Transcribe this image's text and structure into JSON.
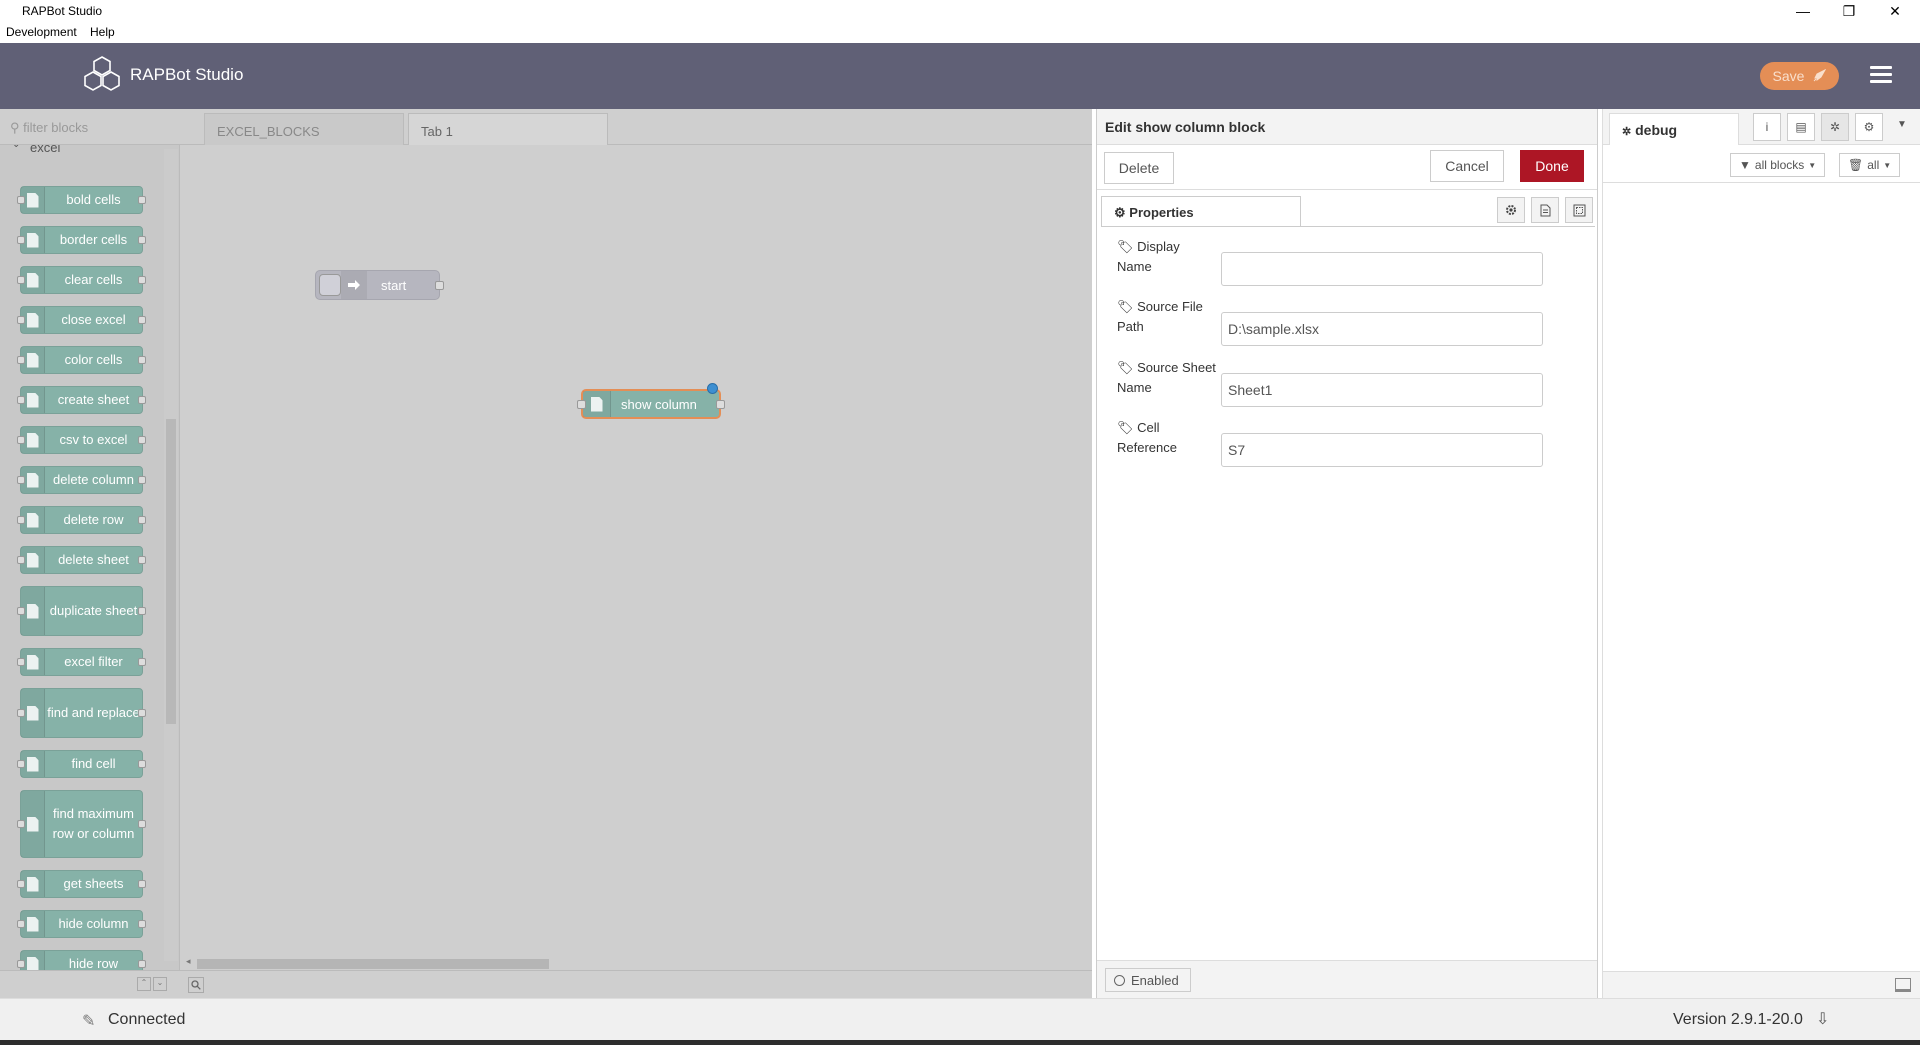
{
  "window": {
    "title": "RAPBot Studio",
    "minimize": "—",
    "restore": "❐",
    "close": "✕"
  },
  "menu": [
    "Development",
    "Help"
  ],
  "header": {
    "app_name": "RAPBot Studio",
    "save_label": "Save"
  },
  "palette": {
    "filter_placeholder": "filter blocks",
    "category": "excel",
    "nodes": [
      "bold cells",
      "border cells",
      "clear cells",
      "close excel",
      "color cells",
      "create sheet",
      "csv to excel",
      "delete column",
      "delete row",
      "delete sheet",
      "duplicate sheet",
      "excel filter",
      "find and replace",
      "find cell",
      "find maximum row or column",
      "get sheets",
      "hide column",
      "hide row"
    ]
  },
  "workspace": {
    "tabs": [
      "EXCEL_BLOCKS",
      "Tab 1"
    ],
    "nodes": {
      "start": "start",
      "show_column": "show column"
    }
  },
  "editor": {
    "title": "Edit show column block",
    "delete_label": "Delete",
    "cancel_label": "Cancel",
    "done_label": "Done",
    "properties_tab": "Properties",
    "fields": [
      {
        "label": "Display Name",
        "value": ""
      },
      {
        "label": "Source File Path",
        "value": "D:\\sample.xlsx"
      },
      {
        "label": "Source Sheet Name",
        "value": "Sheet1"
      },
      {
        "label": "Cell Reference",
        "value": "S7"
      }
    ],
    "enabled_label": "Enabled"
  },
  "sidebar": {
    "tab_label": "debug",
    "filter_label": "all blocks",
    "clear_label": "all"
  },
  "status": {
    "connection": "Connected",
    "version": "Version 2.9.1-20.0"
  },
  "colors": {
    "header": "#606076",
    "save": "#e48e56",
    "done": "#ad1625",
    "node": "#86b2a8"
  }
}
